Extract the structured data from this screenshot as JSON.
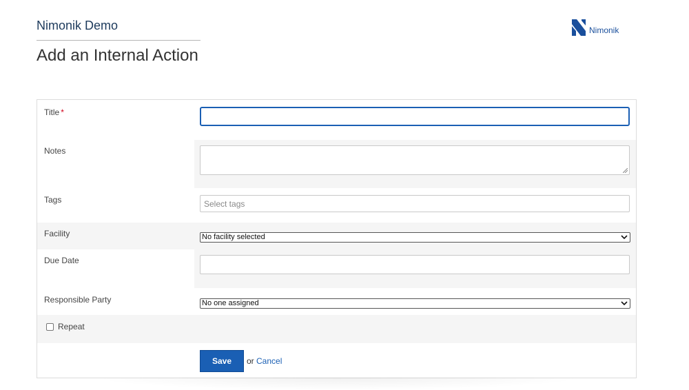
{
  "header": {
    "org_name": "Nimonik Demo",
    "page_title": "Add an Internal Action",
    "logo_text": "Nimonik"
  },
  "form": {
    "title_label": "Title",
    "title_required_marker": "*",
    "title_value": "",
    "notes_label": "Notes",
    "notes_value": "",
    "tags_label": "Tags",
    "tags_placeholder": "Select tags",
    "facility_label": "Facility",
    "facility_selected": "No facility selected",
    "due_date_label": "Due Date",
    "due_date_value": "",
    "responsible_label": "Responsible Party",
    "responsible_selected": "No one assigned",
    "repeat_label": "Repeat",
    "repeat_checked": false
  },
  "actions": {
    "save_label": "Save",
    "or_text": "or",
    "cancel_label": "Cancel"
  },
  "colors": {
    "brand_blue": "#1a5fb4",
    "org_name": "#1d3a5c",
    "required": "#d0021b"
  }
}
